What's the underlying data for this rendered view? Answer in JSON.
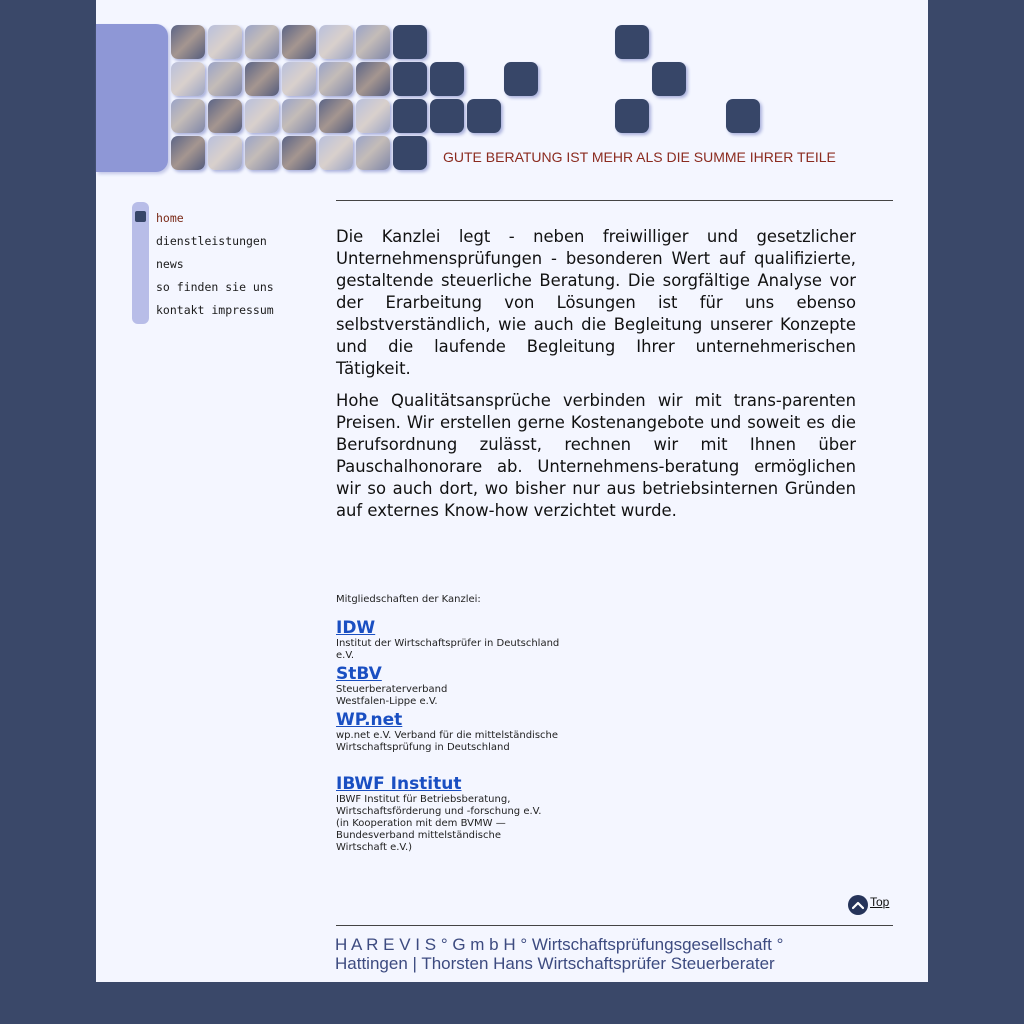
{
  "header": {
    "slogan": "GUTE BERATUNG IST MEHR ALS DIE SUMME IHRER TEILE"
  },
  "nav": {
    "items": [
      {
        "label": "home",
        "active": true
      },
      {
        "label": "dienstleistungen",
        "active": false
      },
      {
        "label": "news",
        "active": false
      },
      {
        "label": "so finden sie uns",
        "active": false
      },
      {
        "label": "kontakt impressum",
        "active": false
      }
    ]
  },
  "content": {
    "paragraph1": "Die Kanzlei legt - neben freiwilliger und gesetzlicher Unternehmensprüfungen - besonderen Wert auf qualifizierte, gestaltende steuerliche Beratung. Die sorgfältige Analyse vor der Erarbeitung von Lösungen ist für uns ebenso selbstverständlich, wie auch die Begleitung unserer Konzepte und die laufende Begleitung Ihrer unternehmerischen Tätigkeit.",
    "paragraph2": "Hohe Qualitätsansprüche verbinden wir mit trans-parenten Preisen. Wir erstellen gerne Kostenangebote und soweit es die Berufsordnung zulässt, rechnen wir mit Ihnen über Pauschalhonorare ab. Unternehmens-beratung ermöglichen wir so auch dort, wo bisher nur aus betriebsinternen Gründen auf externes Know-how verzichtet wurde."
  },
  "memberships": {
    "title": "Mitgliedschaften der Kanzlei:",
    "items": [
      {
        "name": "IDW",
        "description": "Institut der Wirtschaftsprüfer in Deutschland\ne.V."
      },
      {
        "name": "StBV",
        "description": "Steuerberaterverband\nWestfalen-Lippe e.V."
      },
      {
        "name": "WP.net",
        "description": "wp.net e.V. Verband für die mittelständische\nWirtschaftsprüfung in Deutschland"
      },
      {
        "name": "IBWF Institut ",
        "description": "IBWF Institut für Betriebsberatung,\nWirtschaftsförderung und -forschung e.V.\n(in Kooperation mit dem BVMW —\nBundesverband mittelständische\nWirtschaft e.V.)"
      }
    ]
  },
  "top_link": {
    "label": "Top",
    "icon": "chevron-up-icon"
  },
  "footer": {
    "text": "H A R E V I S ° G m b H ° Wirtschaftsprüfungsgesellschaft ° Hattingen  | Thorsten Hans Wirtschaftsprüfer Steuerberater"
  },
  "colors": {
    "background": "#3a4869",
    "page": "#f4f6ff",
    "tile": "#374668",
    "accent_bar": "#8e97d6",
    "slogan": "#8b2b1f",
    "link": "#1a4fc2",
    "footer": "#3d4b80"
  }
}
